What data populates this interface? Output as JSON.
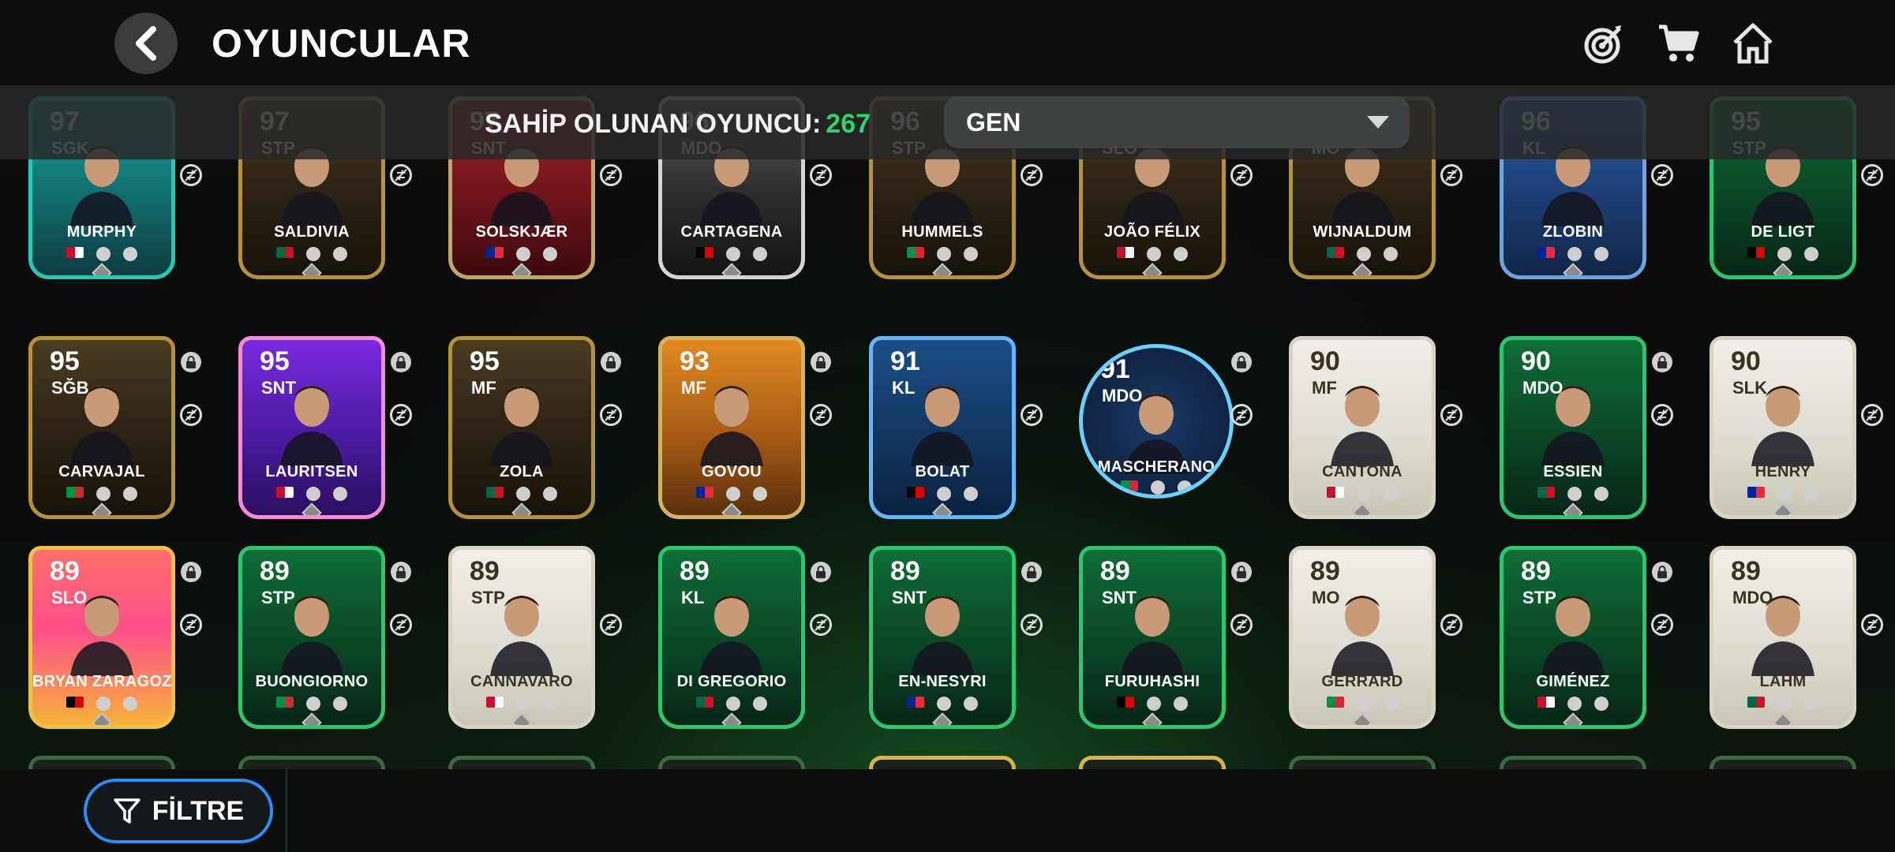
{
  "header": {
    "title": "OYUNCULAR",
    "icons": [
      "back-icon",
      "target-icon",
      "cart-icon",
      "home-icon"
    ]
  },
  "subbar": {
    "owned_label": "SAHİP OLUNAN OYUNCU:",
    "owned_count": "267",
    "sort_value": "GEN"
  },
  "colors": {
    "accent_green": "#2fd26a",
    "filter_border": "#2f8cff"
  },
  "cards": [
    {
      "rating": "97",
      "pos": "SGK",
      "name": "MURPHY",
      "theme": "t-teal",
      "locked": false
    },
    {
      "rating": "97",
      "pos": "STP",
      "name": "SALDIVIA",
      "theme": "t-gold",
      "locked": false
    },
    {
      "rating": "97",
      "pos": "SNT",
      "name": "SOLSKJÆR",
      "theme": "t-red",
      "locked": false
    },
    {
      "rating": "96",
      "pos": "MDO",
      "name": "CARTAGENA",
      "theme": "t-silver",
      "locked": false
    },
    {
      "rating": "96",
      "pos": "STP",
      "name": "HUMMELS",
      "theme": "t-gold",
      "locked": false
    },
    {
      "rating": "96",
      "pos": "SLO",
      "name": "JOÃO FÉLIX",
      "theme": "t-gold",
      "locked": false
    },
    {
      "rating": "96",
      "pos": "MO",
      "name": "WIJNALDUM",
      "theme": "t-gold",
      "locked": false
    },
    {
      "rating": "96",
      "pos": "KL",
      "name": "ZLOBIN",
      "theme": "t-blue",
      "locked": false
    },
    {
      "rating": "95",
      "pos": "STP",
      "name": "DE LIGT",
      "theme": "t-green",
      "locked": false
    },
    {
      "rating": "95",
      "pos": "SĞB",
      "name": "CARVAJAL",
      "theme": "t-gold",
      "locked": true
    },
    {
      "rating": "95",
      "pos": "SNT",
      "name": "LAURITSEN",
      "theme": "t-purple",
      "locked": true
    },
    {
      "rating": "95",
      "pos": "MF",
      "name": "ZOLA",
      "theme": "t-gold",
      "locked": true
    },
    {
      "rating": "93",
      "pos": "MF",
      "name": "GOVOU",
      "theme": "t-orange",
      "locked": true
    },
    {
      "rating": "91",
      "pos": "KL",
      "name": "BOLAT",
      "theme": "t-darkblue",
      "locked": false
    },
    {
      "rating": "91",
      "pos": "MDO",
      "name": "MASCHERANO",
      "theme": "t-darkblue t-circle",
      "locked": true
    },
    {
      "rating": "90",
      "pos": "MF",
      "name": "CANTONA",
      "theme": "t-icon",
      "locked": false
    },
    {
      "rating": "90",
      "pos": "MDO",
      "name": "ESSIEN",
      "theme": "t-green",
      "locked": true
    },
    {
      "rating": "90",
      "pos": "SLK",
      "name": "HENRY",
      "theme": "t-icon",
      "locked": false
    },
    {
      "rating": "89",
      "pos": "SLO",
      "name": "BRYAN ZARAGOZA",
      "theme": "t-pink",
      "locked": true
    },
    {
      "rating": "89",
      "pos": "STP",
      "name": "BUONGIORNO",
      "theme": "t-green",
      "locked": true
    },
    {
      "rating": "89",
      "pos": "STP",
      "name": "CANNAVARO",
      "theme": "t-icon",
      "locked": false
    },
    {
      "rating": "89",
      "pos": "KL",
      "name": "DI GREGORIO",
      "theme": "t-green",
      "locked": true
    },
    {
      "rating": "89",
      "pos": "SNT",
      "name": "EN-NESYRI",
      "theme": "t-green",
      "locked": true
    },
    {
      "rating": "89",
      "pos": "SNT",
      "name": "FURUHASHI",
      "theme": "t-green",
      "locked": true
    },
    {
      "rating": "89",
      "pos": "MO",
      "name": "GERRARD",
      "theme": "t-icon",
      "locked": false
    },
    {
      "rating": "89",
      "pos": "STP",
      "name": "GIMÉNEZ",
      "theme": "t-green",
      "locked": true
    },
    {
      "rating": "89",
      "pos": "MDO",
      "name": "LAHM",
      "theme": "t-icon",
      "locked": false
    }
  ],
  "footer": {
    "filter_label": "FİLTRE"
  }
}
